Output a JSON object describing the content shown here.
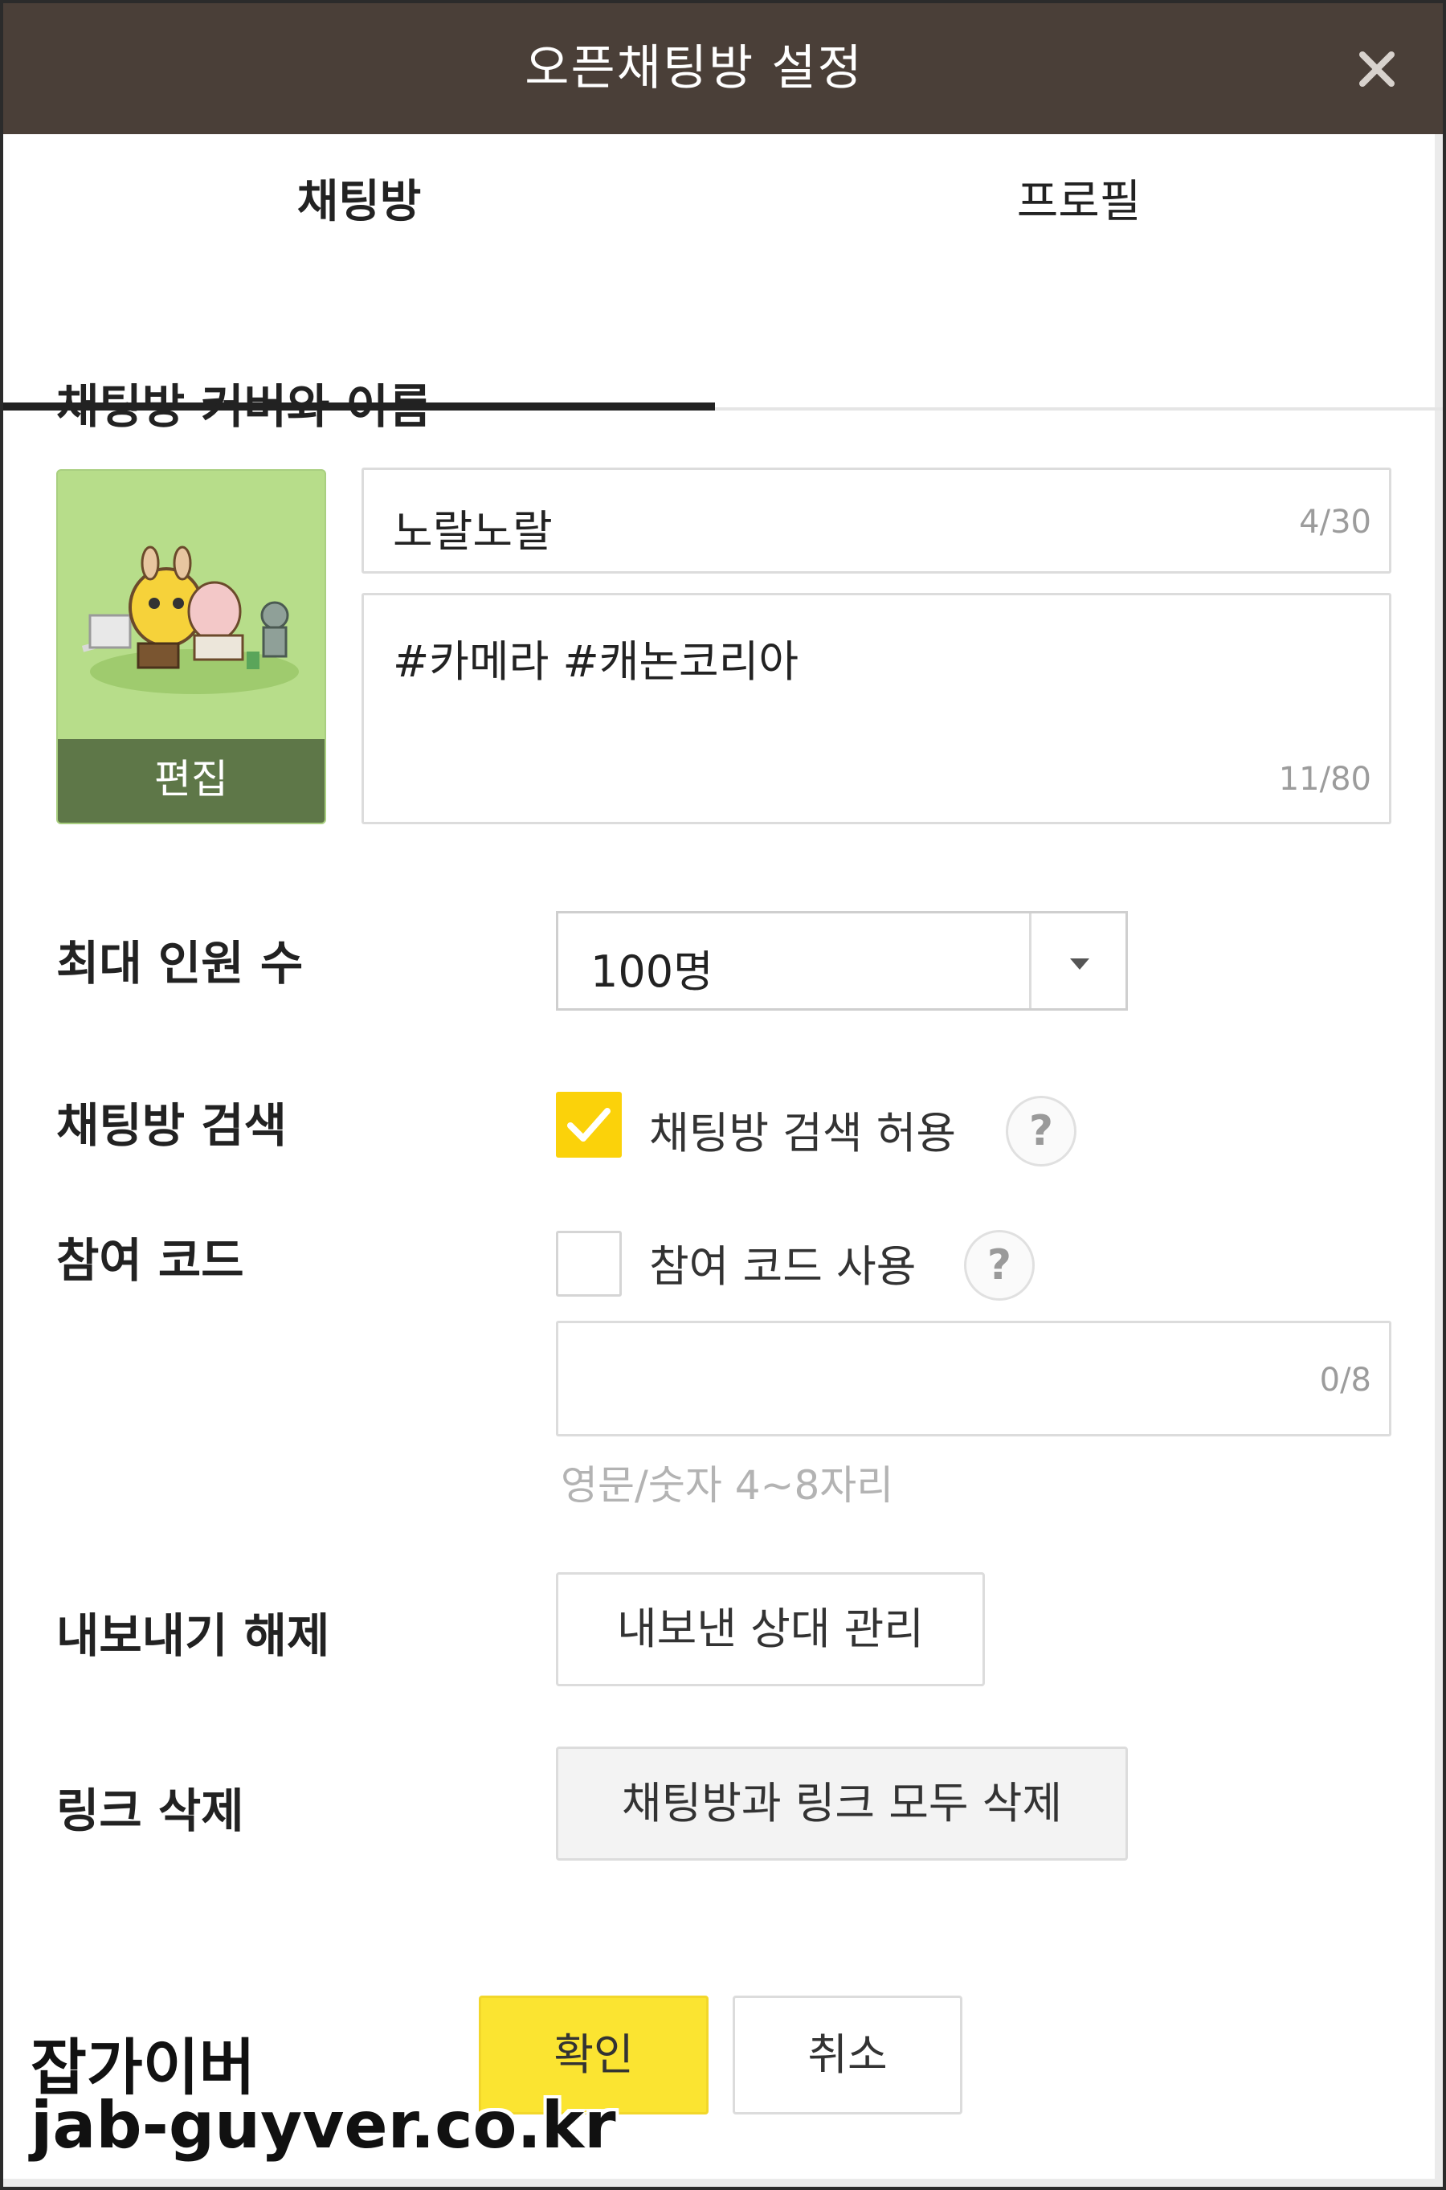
{
  "window": {
    "title": "오픈채팅방 설정",
    "close_icon": "close-icon"
  },
  "tabs": [
    {
      "label": "채팅방",
      "active": true
    },
    {
      "label": "프로필",
      "active": false
    }
  ],
  "section": {
    "title": "채팅방 커버와 이름"
  },
  "cover": {
    "edit_label": "편집"
  },
  "name_input": {
    "value": "노랄노랄",
    "counter": "4/30"
  },
  "desc_input": {
    "value": "#카메라 #캐논코리아",
    "counter": "11/80"
  },
  "max_members": {
    "label": "최대 인원 수",
    "selected": "100명"
  },
  "search": {
    "label": "채팅방 검색",
    "checkbox_label": "채팅방 검색 허용",
    "checked": true,
    "help": "?"
  },
  "join_code": {
    "label": "참여 코드",
    "checkbox_label": "참여 코드 사용",
    "checked": false,
    "help": "?",
    "counter": "0/8",
    "hint": "영문/숫자 4~8자리"
  },
  "export": {
    "label": "내보내기 해제",
    "button": "내보낸 상대 관리"
  },
  "link_delete": {
    "label": "링크 삭제",
    "button": "채팅방과 링크 모두 삭제"
  },
  "footer": {
    "confirm": "확인",
    "cancel": "취소"
  },
  "watermark": {
    "line1": "잡가이버",
    "line2": "jab-guyver.co.kr"
  },
  "colors": {
    "titlebar": "#4a3f38",
    "accent_yellow": "#fbe431",
    "checkbox_yellow": "#fbd20a",
    "cover_green": "#b7dd8a"
  }
}
